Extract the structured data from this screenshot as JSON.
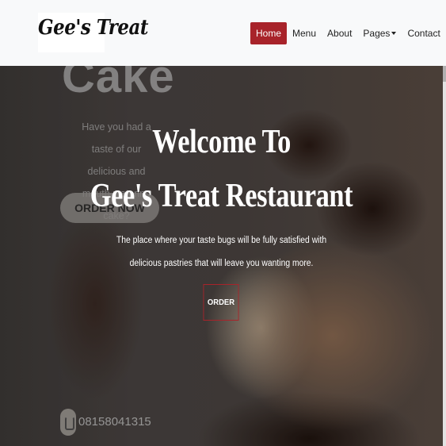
{
  "navbar": {
    "logo_text": "Gee's Treat",
    "items": [
      {
        "label": "Home",
        "active": true
      },
      {
        "label": "Menu"
      },
      {
        "label": "About"
      },
      {
        "label": "Pages",
        "dropdown": true
      },
      {
        "label": "Contact"
      }
    ]
  },
  "hero": {
    "title_line1": "Welcome To",
    "title_line2": "Gee's Treat Restaurant",
    "description": "The place where your taste bugs will be fully satisfied with delicious pastries that will leave you wanting more.",
    "order_button": "ORDER"
  },
  "background_slide": {
    "heading": "Cake",
    "tagline": "Have you had a taste of our delicious and mouth-watering cake?",
    "order_button": "ORDER NOW",
    "phone": "08158041315"
  },
  "colors": {
    "accent": "#a8232a",
    "navbar_bg": "#f8f9fa"
  }
}
